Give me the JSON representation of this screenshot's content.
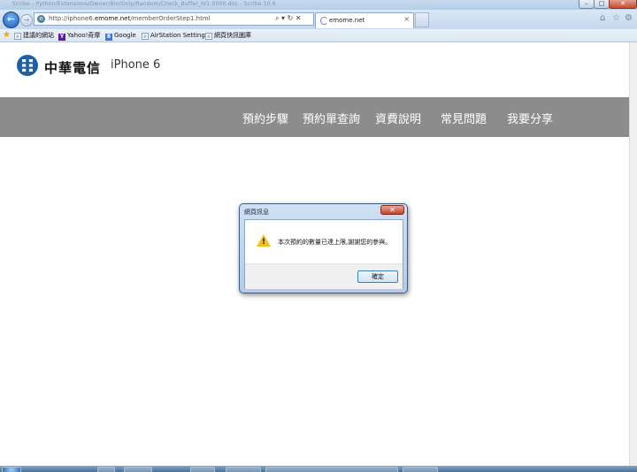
{
  "browser": {
    "window_title": "Scribe - Python/Extensions/Owner/Bin/Only/Random/Check_Buffer_IV1.0000.doc - Scribe 10.6",
    "url_prefix": "http://iphone6.",
    "url_domain": "emome.net",
    "url_suffix": "/memberOrderStep1.html",
    "address_controls": "⌕ ▾ ↻ ✕",
    "tab_title": "emome.net",
    "tab_close": "×",
    "nav_back": "←",
    "nav_forward": "→",
    "window_buttons": {
      "minimize": "–",
      "maximize": "□",
      "close": "✕"
    },
    "right_icons": {
      "home": "⌂",
      "favorites": "☆",
      "tools": "⚙"
    }
  },
  "favorites_bar": {
    "items": [
      {
        "label": "建議的網站",
        "icon": "page-icon"
      },
      {
        "label": "Yahoo!奇摩",
        "icon": "yahoo-icon",
        "glyph": "Y"
      },
      {
        "label": "Google",
        "icon": "google-icon",
        "glyph": "8"
      },
      {
        "label": "AirStation Settings",
        "icon": "page-icon"
      },
      {
        "label": "網頁快訊圖庫",
        "icon": "page-icon"
      }
    ]
  },
  "site": {
    "brand": "中華電信",
    "product": "iPhone 6",
    "menu": [
      "預約步驟",
      "預約單查詢",
      "資費說明",
      "常見問題",
      "我要分享"
    ],
    "menu_color": "#8c8c8c",
    "logo_color": "#1f5fa8"
  },
  "dialog": {
    "title": "網頁訊息",
    "message": "本次預約的數量已達上限,謝謝您的參與。",
    "ok_label": "確定",
    "close_glyph": "✕",
    "warning_glyph": "!"
  }
}
